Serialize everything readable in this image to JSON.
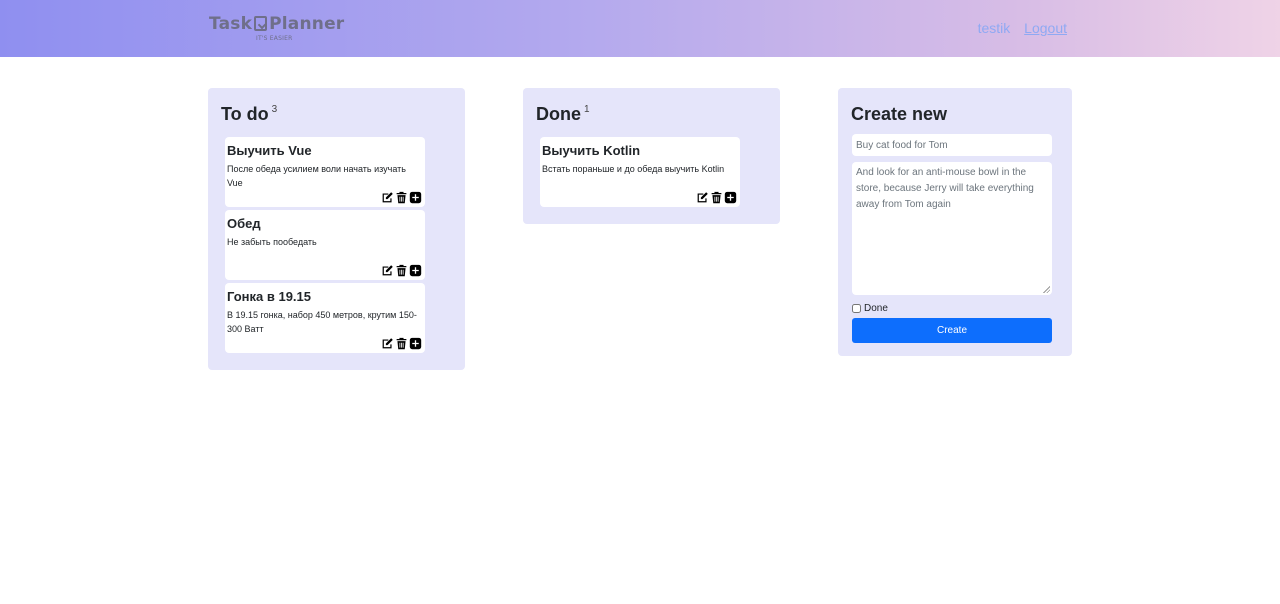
{
  "header": {
    "logo": {
      "text_left": "Task",
      "text_right": "Planner",
      "tagline": "IT'S EASIER"
    },
    "user_link": "testik",
    "logout_link": "Logout"
  },
  "columns": {
    "todo": {
      "title": "To do",
      "count": "3",
      "tasks": [
        {
          "title": "Выучить Vue",
          "description": "После обеда усилием воли начать изучать Vue"
        },
        {
          "title": "Обед",
          "description": "Не забыть пообедать"
        },
        {
          "title": "Гонка в 19.15",
          "description": "В 19.15 гонка, набор 450 метров, крутим 150-300 Ватт"
        }
      ]
    },
    "done": {
      "title": "Done",
      "count": "1",
      "tasks": [
        {
          "title": "Выучить Kotlin",
          "description": "Встать пораньше и до обеда выучить Kotlin"
        }
      ]
    }
  },
  "create": {
    "title": "Create new",
    "title_placeholder": "Buy cat food for Tom",
    "description_placeholder": "And look for an anti-mouse bowl in the store, because Jerry will take everything away from Tom again",
    "done_label": "Done",
    "done_checked": false,
    "button_label": "Create"
  },
  "icons": {
    "edit": "edit-icon",
    "delete": "trash-icon",
    "add": "plus-icon"
  },
  "colors": {
    "accent": "#0d6efd",
    "column_bg": "#e5e5fa",
    "link": "#8fa9f3"
  }
}
